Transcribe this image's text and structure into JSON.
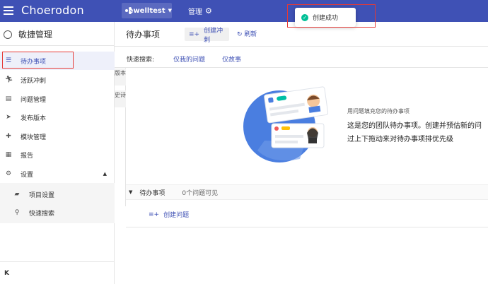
{
  "header": {
    "brand": "Choerodon",
    "project": "ewelltest",
    "manage": "管理"
  },
  "toast": {
    "message": "创建成功"
  },
  "sidebar": {
    "title": "敏捷管理",
    "items": [
      {
        "label": "待办事项",
        "icon": "list-icon"
      },
      {
        "label": "活跃冲刺",
        "icon": "run-icon"
      },
      {
        "label": "问题管理",
        "icon": "clipboard-icon"
      },
      {
        "label": "发布版本",
        "icon": "send-icon"
      },
      {
        "label": "模块管理",
        "icon": "puzzle-icon"
      },
      {
        "label": "报告",
        "icon": "report-icon"
      },
      {
        "label": "设置",
        "icon": "gear-icon"
      }
    ],
    "sub_items": [
      {
        "label": "项目设置",
        "icon": "folder-icon"
      },
      {
        "label": "快速搜索",
        "icon": "search-icon"
      }
    ],
    "collapse": "K"
  },
  "main": {
    "title": "待办事项",
    "create_sprint": "创建冲刺",
    "refresh": "刷新",
    "quick_search_label": "快速搜索:",
    "quick_filters": [
      "仅我的问题",
      "仅故事"
    ],
    "side_tabs": [
      "版本",
      "史诗"
    ],
    "empty": {
      "subtitle": "用问题填充您的待办事项",
      "line1": "这是您的团队待办事项。创建并预估新的问",
      "line2": "过上下拖动来对待办事项排优先级"
    },
    "backlog": {
      "name": "待办事项",
      "count": "0个问题可见",
      "create_issue": "创建问题"
    }
  },
  "colors": {
    "primary": "#3f51b5",
    "success": "#00bf96",
    "annotation": "#e53935"
  }
}
